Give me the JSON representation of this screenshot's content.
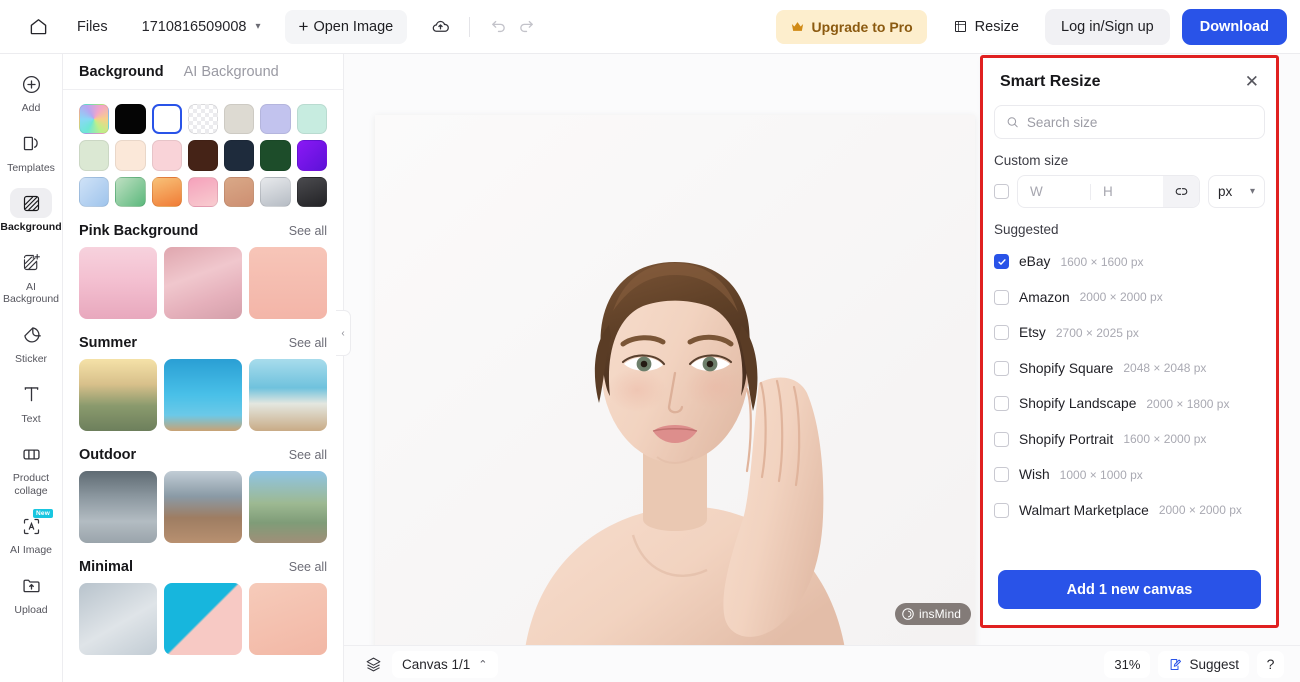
{
  "topbar": {
    "home_icon": "home-icon",
    "files_label": "Files",
    "document_name": "1710816509008",
    "open_image_label": "Open Image",
    "cloud_icon": "cloud-save-icon",
    "undo_icon": "undo-icon",
    "redo_icon": "redo-icon",
    "upgrade_label": "Upgrade to Pro",
    "upgrade_icon": "crown-icon",
    "resize_label": "Resize",
    "resize_icon": "resize-frame-icon",
    "login_label": "Log in/Sign up",
    "download_label": "Download",
    "accent_blue": "#2953e8",
    "upgrade_bg": "#fdeecd"
  },
  "rail": {
    "items": [
      {
        "label": "Add",
        "icon": "plus-circle-icon",
        "active": false
      },
      {
        "label": "Templates",
        "icon": "templates-icon",
        "active": false
      },
      {
        "label": "Background",
        "icon": "background-icon",
        "active": true
      },
      {
        "label": "AI Background",
        "icon": "ai-background-icon",
        "active": false
      },
      {
        "label": "Sticker",
        "icon": "sticker-icon",
        "active": false
      },
      {
        "label": "Text",
        "icon": "text-icon",
        "active": false
      },
      {
        "label": "Product collage",
        "icon": "product-collage-icon",
        "active": false
      },
      {
        "label": "AI Image",
        "icon": "ai-image-icon",
        "active": false,
        "badge": "New"
      },
      {
        "label": "Upload",
        "icon": "upload-icon",
        "active": false
      }
    ]
  },
  "panel": {
    "tabs": [
      {
        "label": "Background",
        "active": true
      },
      {
        "label": "AI Background",
        "active": false
      }
    ],
    "swatches": [
      {
        "name": "rainbow-gradient",
        "selected": false
      },
      {
        "name": "black",
        "selected": false
      },
      {
        "name": "white",
        "selected": true
      },
      {
        "name": "transparent",
        "selected": false
      },
      {
        "name": "beige",
        "selected": false
      },
      {
        "name": "periwinkle",
        "selected": false
      },
      {
        "name": "mint",
        "selected": false
      },
      {
        "name": "sage",
        "selected": false
      },
      {
        "name": "cream",
        "selected": false
      },
      {
        "name": "blush-pink",
        "selected": false
      },
      {
        "name": "dark-brown",
        "selected": false
      },
      {
        "name": "navy",
        "selected": false
      },
      {
        "name": "forest-green",
        "selected": false
      },
      {
        "name": "violet-gradient",
        "selected": false
      },
      {
        "name": "light-blue-gradient",
        "selected": false
      },
      {
        "name": "green-gradient",
        "selected": false
      },
      {
        "name": "orange-gradient",
        "selected": false
      },
      {
        "name": "pink-gradient",
        "selected": false
      },
      {
        "name": "tan-gradient",
        "selected": false
      },
      {
        "name": "silver-gradient",
        "selected": false
      },
      {
        "name": "charcoal-gradient",
        "selected": false
      }
    ],
    "sections": [
      {
        "title": "Pink Background",
        "see_all": "See all",
        "thumbs": [
          "pink-petals-podium",
          "pink-curtain-window",
          "pink-tulips"
        ]
      },
      {
        "title": "Summer",
        "see_all": "See all",
        "thumbs": [
          "palm-sunset-podium",
          "pool-water-deck",
          "beach-shore"
        ]
      },
      {
        "title": "Outdoor",
        "see_all": "See all",
        "thumbs": [
          "wet-stone-path",
          "coastal-cliff",
          "mountain-forest"
        ]
      },
      {
        "title": "Minimal",
        "see_all": "See all",
        "thumbs": [
          "grey-blue-gradient",
          "cyan-pink-split",
          "peach-gradient"
        ]
      }
    ],
    "collapse_icon": "chevron-left-icon"
  },
  "canvas": {
    "image_name": "beauty-model-portrait",
    "watermark": "insMind",
    "watermark_icon": "insmind-logo-icon"
  },
  "bottombar": {
    "layers_icon": "layers-icon",
    "canvas_label": "Canvas 1/1",
    "canvas_chevron": "chevron-up-icon",
    "zoom_level": "31%",
    "suggest_label": "Suggest",
    "suggest_icon": "suggest-pencil-icon",
    "help_label": "?"
  },
  "smart_resize": {
    "title": "Smart Resize",
    "close_icon": "close-icon",
    "search_icon": "search-icon",
    "search_placeholder": "Search size",
    "search_value": "",
    "custom_size_label": "Custom size",
    "custom_checked": false,
    "width_placeholder": "W",
    "width_value": "",
    "height_placeholder": "H",
    "height_value": "",
    "link_icon": "link-aspect-ratio-icon",
    "unit_value": "px",
    "unit_chevron": "chevron-down-icon",
    "suggested_label": "Suggested",
    "sizes": [
      {
        "name": "eBay",
        "dimensions": "1600 × 1600 px",
        "checked": true
      },
      {
        "name": "Amazon",
        "dimensions": "2000 × 2000 px",
        "checked": false
      },
      {
        "name": "Etsy",
        "dimensions": "2700 × 2025 px",
        "checked": false
      },
      {
        "name": "Shopify Square",
        "dimensions": "2048 × 2048 px",
        "checked": false
      },
      {
        "name": "Shopify Landscape",
        "dimensions": "2000 × 1800 px",
        "checked": false
      },
      {
        "name": "Shopify Portrait",
        "dimensions": "1600 × 2000 px",
        "checked": false
      },
      {
        "name": "Wish",
        "dimensions": "1000 × 1000 px",
        "checked": false
      },
      {
        "name": "Walmart Marketplace",
        "dimensions": "2000 × 2000 px",
        "checked": false
      }
    ],
    "add_button_label": "Add 1 new canvas",
    "highlight_color": "#e02020"
  }
}
